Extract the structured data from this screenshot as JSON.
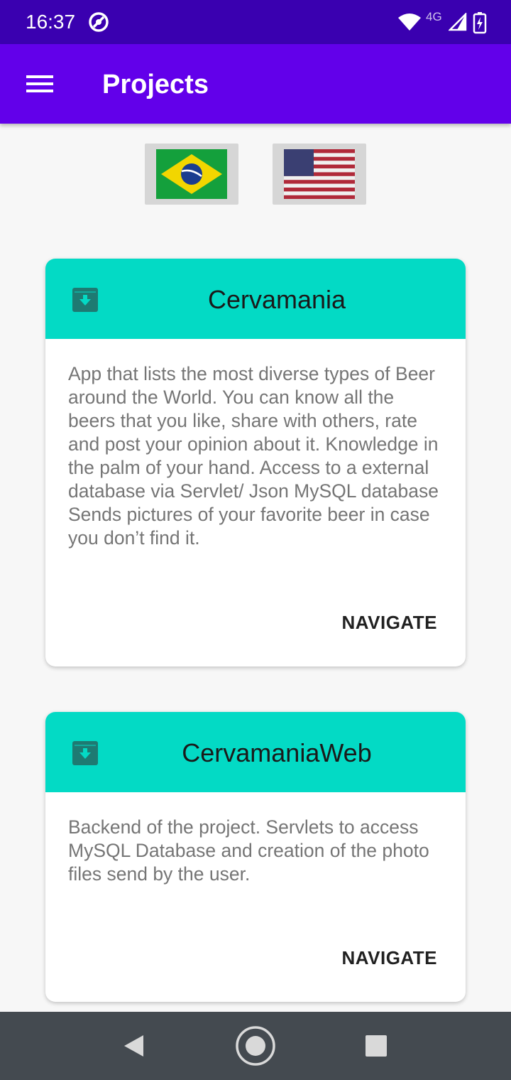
{
  "status_bar": {
    "time": "16:37",
    "network": "4G",
    "icons": [
      "do-not-disturb-icon",
      "wifi-icon",
      "cell-signal-icon",
      "battery-charging-icon"
    ]
  },
  "app_bar": {
    "title": "Projects",
    "menu_icon": "hamburger-menu-icon",
    "color": "#6200ea"
  },
  "language_flags": [
    {
      "name": "brazil-flag",
      "language": "Portuguese"
    },
    {
      "name": "usa-flag",
      "language": "English"
    }
  ],
  "projects": [
    {
      "title": "Cervamania",
      "icon": "archive-download-icon",
      "description": "App that lists the most diverse types of Beer around the World. You can know all the beers that you like, share with others, rate and post your opinion about it. Knowledge in the palm of your hand. Access to a external database via Servlet/ Json MySQL database Sends pictures of your favorite beer in case you don’t find it.",
      "action_label": "NAVIGATE"
    },
    {
      "title": "CervamaniaWeb",
      "icon": "archive-download-icon",
      "description": "Backend of the project. Servlets to access MySQL Database and creation of the photo files send by the user.",
      "action_label": "NAVIGATE"
    }
  ],
  "nav_bar": {
    "buttons": [
      "back-icon",
      "home-icon",
      "recents-icon"
    ]
  },
  "colors": {
    "status_bar": "#3a00b0",
    "app_bar": "#6200ea",
    "card_header": "#03dac5",
    "nav_bar": "#444a50"
  }
}
